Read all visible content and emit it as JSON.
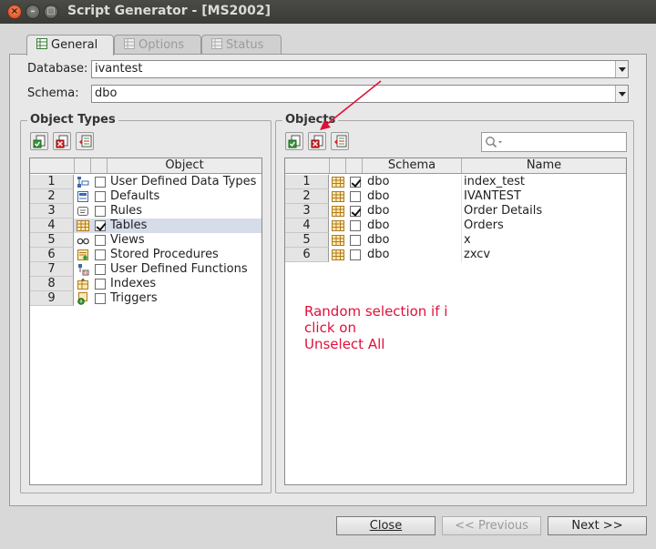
{
  "window": {
    "title": "Script Generator - [MS2002]"
  },
  "tabs": [
    {
      "label": "General",
      "active": true
    },
    {
      "label": "Options",
      "active": false
    },
    {
      "label": "Status",
      "active": false
    }
  ],
  "database": {
    "label": "Database:",
    "value": "ivantest"
  },
  "schema": {
    "label": "Schema:",
    "value": "dbo"
  },
  "object_types": {
    "title": "Object Types",
    "column": "Object",
    "rows": [
      {
        "num": "1",
        "label": "User Defined Data Types",
        "checked": false,
        "icon": "udt-icon"
      },
      {
        "num": "2",
        "label": "Defaults",
        "checked": false,
        "icon": "default-icon"
      },
      {
        "num": "3",
        "label": "Rules",
        "checked": false,
        "icon": "rule-icon"
      },
      {
        "num": "4",
        "label": "Tables",
        "checked": true,
        "icon": "table-icon"
      },
      {
        "num": "5",
        "label": "Views",
        "checked": false,
        "icon": "view-icon"
      },
      {
        "num": "6",
        "label": "Stored Procedures",
        "checked": false,
        "icon": "procedure-icon"
      },
      {
        "num": "7",
        "label": "User Defined Functions",
        "checked": false,
        "icon": "function-icon"
      },
      {
        "num": "8",
        "label": "Indexes",
        "checked": false,
        "icon": "index-icon"
      },
      {
        "num": "9",
        "label": "Triggers",
        "checked": false,
        "icon": "trigger-icon"
      }
    ]
  },
  "objects": {
    "title": "Objects",
    "columns": {
      "schema": "Schema",
      "name": "Name"
    },
    "rows": [
      {
        "num": "1",
        "schema": "dbo",
        "name": "index_test",
        "checked": true
      },
      {
        "num": "2",
        "schema": "dbo",
        "name": "IVANTEST",
        "checked": false
      },
      {
        "num": "3",
        "schema": "dbo",
        "name": "Order Details",
        "checked": true
      },
      {
        "num": "4",
        "schema": "dbo",
        "name": "Orders",
        "checked": false
      },
      {
        "num": "5",
        "schema": "dbo",
        "name": "x",
        "checked": false
      },
      {
        "num": "6",
        "schema": "dbo",
        "name": "zxcv",
        "checked": false
      }
    ]
  },
  "annotation": {
    "line1": "Random selection if i",
    "line2": "click on",
    "line3": "Unselect All",
    "color": "#e0103a"
  },
  "buttons": {
    "close": "Close",
    "previous": "<< Previous",
    "next": "Next >>"
  }
}
